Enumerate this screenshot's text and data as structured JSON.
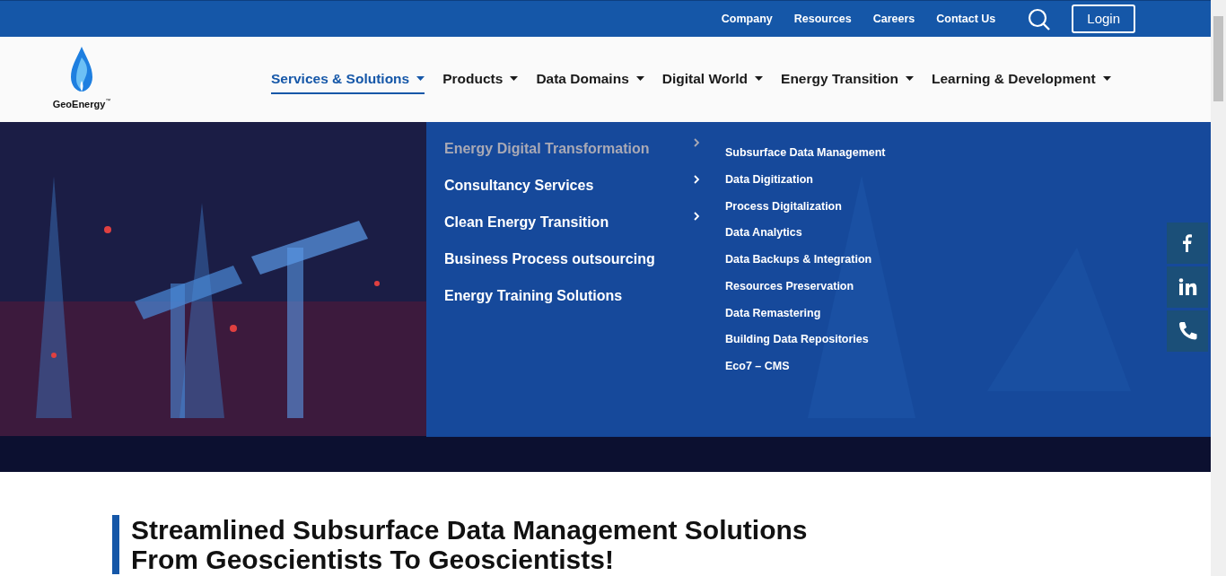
{
  "top_bar": {
    "links": [
      "Company",
      "Resources",
      "Careers",
      "Contact Us"
    ],
    "login": "Login"
  },
  "logo": {
    "name": "GeoEnergy",
    "mark": "™"
  },
  "nav": [
    {
      "label": "Services & Solutions",
      "selected": true
    },
    {
      "label": "Products",
      "selected": false
    },
    {
      "label": "Data Domains",
      "selected": false
    },
    {
      "label": "Digital World",
      "selected": false
    },
    {
      "label": "Energy Transition",
      "selected": false
    },
    {
      "label": "Learning & Development",
      "selected": false
    }
  ],
  "mega_menu": {
    "categories": [
      {
        "label": "Energy Digital Transformation",
        "selected": true,
        "has_submenu": true
      },
      {
        "label": "Consultancy Services",
        "selected": false,
        "has_submenu": true
      },
      {
        "label": "Clean Energy Transition",
        "selected": false,
        "has_submenu": true
      },
      {
        "label": "Business Process outsourcing",
        "selected": false,
        "has_submenu": false
      },
      {
        "label": "Energy Training Solutions",
        "selected": false,
        "has_submenu": false
      }
    ],
    "items": [
      "Subsurface Data Management",
      "Data Digitization",
      "Process Digitalization",
      "Data Analytics",
      "Data Backups & Integration",
      "Resources Preservation",
      "Data Remastering",
      "Building Data Repositories",
      "Eco7 – CMS"
    ]
  },
  "social": [
    {
      "kind": "facebook"
    },
    {
      "kind": "linkedin"
    },
    {
      "kind": "phone"
    }
  ],
  "heading": [
    "Streamlined Subsurface Data Management Solutions",
    "From Geoscientists To Geoscientists!"
  ]
}
